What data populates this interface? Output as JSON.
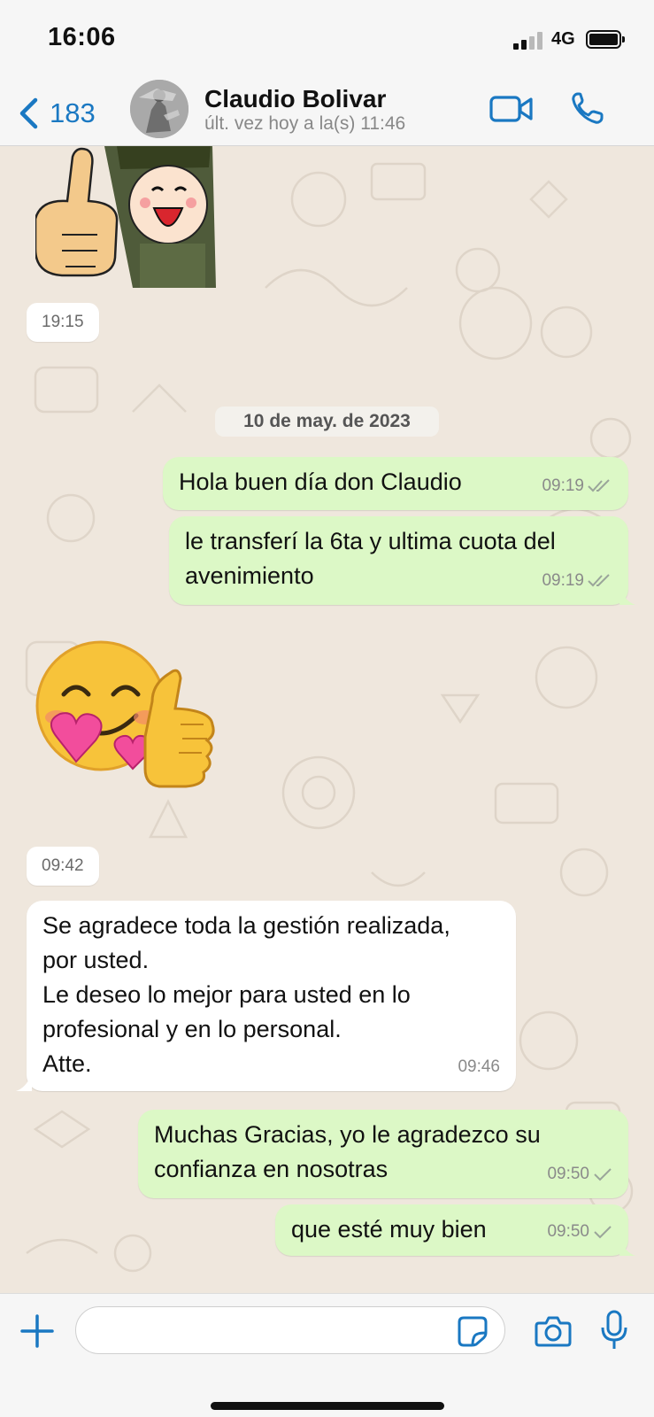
{
  "status_bar": {
    "time": "16:06",
    "network": "4G"
  },
  "header": {
    "back_count": "183",
    "contact_name": "Claudio Bolivar",
    "last_seen": "últ. vez hoy a la(s) 11:46",
    "icons": [
      "chevron-left-icon",
      "video-icon",
      "phone-icon"
    ]
  },
  "chat": {
    "sticker_1_time": "19:15",
    "date_separator": "10 de may. de 2023",
    "messages": [
      {
        "direction": "out",
        "text": "Hola buen día don Claudio",
        "time": "09:19",
        "status": "read"
      },
      {
        "direction": "out",
        "text_lines": [
          "le transferí la 6ta y ultima cuota del",
          "avenimiento"
        ],
        "time": "09:19",
        "status": "read"
      },
      {
        "direction": "in",
        "type": "sticker",
        "time": "09:42"
      },
      {
        "direction": "in",
        "text_lines": [
          "Se agradece toda la gestión realizada,",
          "por usted.",
          "Le deseo lo mejor para usted en lo",
          "profesional y en lo personal.",
          "Atte."
        ],
        "time": "09:46"
      },
      {
        "direction": "out",
        "text_lines": [
          "Muchas Gracias, yo le agradezco su",
          "confianza en nosotras"
        ],
        "time": "09:50",
        "status": "sent"
      },
      {
        "direction": "out",
        "text": "que esté muy bien",
        "time": "09:50",
        "status": "sent"
      }
    ]
  },
  "composer": {
    "placeholder": "",
    "icons": [
      "plus-icon",
      "sticker-icon",
      "camera-icon",
      "microphone-icon"
    ]
  },
  "colors": {
    "accent": "#1a78c2",
    "outgoing_bubble": "#dcf8c6",
    "incoming_bubble": "#ffffff",
    "chat_background": "#efe7dd"
  }
}
